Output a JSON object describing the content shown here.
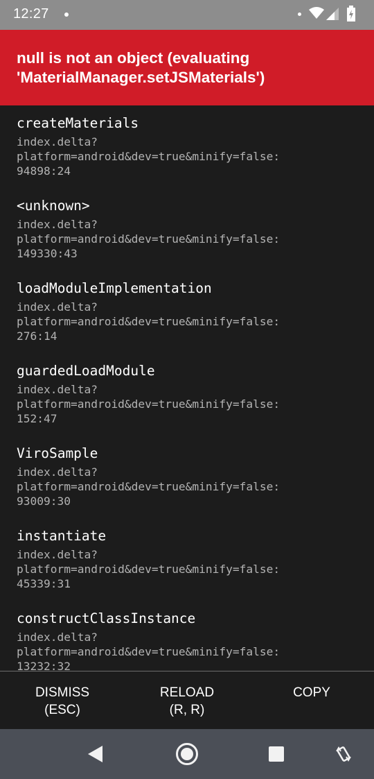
{
  "status_bar": {
    "time": "12:27"
  },
  "error": {
    "message": "null is not an object (evaluating 'MaterialManager.setJSMaterials')"
  },
  "stack_frames": [
    {
      "function": "createMaterials",
      "location_line1": "index.delta?",
      "location_line2": "platform=android&dev=true&minify=false:",
      "location_line3": "94898:24"
    },
    {
      "function": "<unknown>",
      "location_line1": "index.delta?",
      "location_line2": "platform=android&dev=true&minify=false:",
      "location_line3": "149330:43"
    },
    {
      "function": "loadModuleImplementation",
      "location_line1": "index.delta?",
      "location_line2": "platform=android&dev=true&minify=false:",
      "location_line3": "276:14"
    },
    {
      "function": "guardedLoadModule",
      "location_line1": "index.delta?",
      "location_line2": "platform=android&dev=true&minify=false:",
      "location_line3": "152:47"
    },
    {
      "function": "ViroSample",
      "location_line1": "index.delta?",
      "location_line2": "platform=android&dev=true&minify=false:",
      "location_line3": "93009:30"
    },
    {
      "function": "instantiate",
      "location_line1": "index.delta?",
      "location_line2": "platform=android&dev=true&minify=false:",
      "location_line3": "45339:31"
    },
    {
      "function": "constructClassInstance",
      "location_line1": "index.delta?",
      "location_line2": "platform=android&dev=true&minify=false:",
      "location_line3": "13232:32"
    }
  ],
  "actions": {
    "dismiss_label": "DISMISS",
    "dismiss_shortcut": "(ESC)",
    "reload_label": "RELOAD",
    "reload_shortcut": "(R, R)",
    "copy_label": "COPY"
  },
  "nav_bar": {
    "icons": [
      "back-icon",
      "home-icon",
      "recents-icon",
      "rotate-icon"
    ]
  },
  "colors": {
    "status_bar": "#8d8d8d",
    "error_header": "#d01c28",
    "background": "#1c1c1c",
    "nav_bar": "#4b4f57",
    "location_text": "#b3b3b3"
  }
}
